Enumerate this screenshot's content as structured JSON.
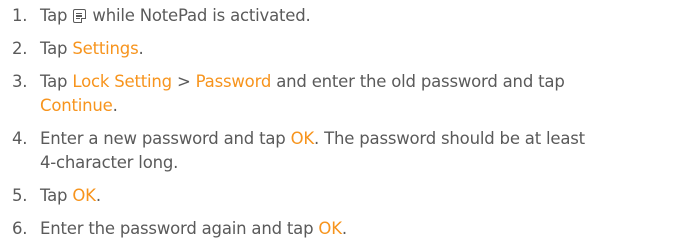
{
  "steps": [
    {
      "number": "1.",
      "parts": [
        {
          "text": "Tap "
        },
        {
          "icon": "menu-icon"
        },
        {
          "text": " while NotePad is activated."
        }
      ]
    },
    {
      "number": "2.",
      "parts": [
        {
          "text": "Tap "
        },
        {
          "text": "Settings",
          "highlight": true
        },
        {
          "text": "."
        }
      ]
    },
    {
      "number": "3.",
      "parts": [
        {
          "text": "Tap "
        },
        {
          "text": "Lock Setting",
          "highlight": true
        },
        {
          "text": " > "
        },
        {
          "text": "Password",
          "highlight": true
        },
        {
          "text": " and enter the old password and tap"
        },
        {
          "br": true
        },
        {
          "text": "Continue",
          "highlight": true
        },
        {
          "text": "."
        }
      ]
    },
    {
      "number": "4.",
      "parts": [
        {
          "text": "Enter a new password and tap "
        },
        {
          "text": "OK",
          "highlight": true
        },
        {
          "text": ". The password should be at least"
        },
        {
          "br": true
        },
        {
          "text": "4-character long."
        }
      ]
    },
    {
      "number": "5.",
      "parts": [
        {
          "text": "Tap "
        },
        {
          "text": "OK",
          "highlight": true
        },
        {
          "text": "."
        }
      ]
    },
    {
      "number": "6.",
      "parts": [
        {
          "text": "Enter the password again and tap "
        },
        {
          "text": "OK",
          "highlight": true
        },
        {
          "text": "."
        }
      ]
    }
  ],
  "colors": {
    "text": "#5a5a5a",
    "highlight": "#f7941d"
  }
}
